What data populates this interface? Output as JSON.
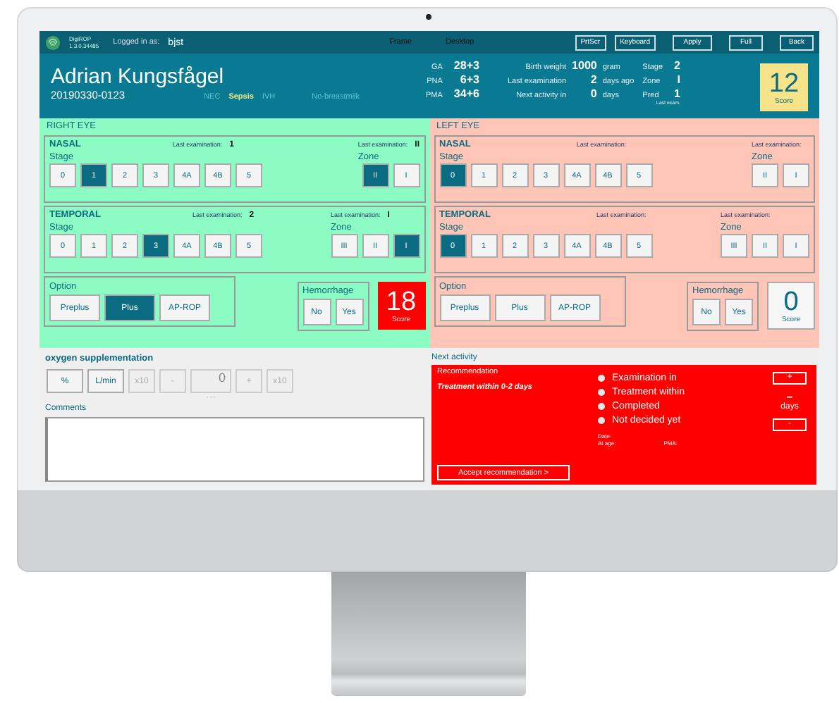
{
  "topbar": {
    "app_name": "DigiROP",
    "version": "1.3.0.34485",
    "logged_in_label": "Logged in as:",
    "user": "bjst",
    "views": [
      "Frame",
      "Desktop"
    ],
    "buttons": [
      "PrtScr",
      "Keyboard",
      "Apply",
      "Full",
      "Back"
    ]
  },
  "patient": {
    "name": "Adrian Kungsfågel",
    "id": "20190330-0123",
    "flags": [
      {
        "label": "NEC",
        "active": false
      },
      {
        "label": "Sepsis",
        "active": true
      },
      {
        "label": "IVH",
        "active": false
      },
      {
        "label": "No-breastmilk",
        "active": false
      }
    ],
    "ages": [
      {
        "label": "GA",
        "value": "28+3"
      },
      {
        "label": "PNA",
        "value": "6+3"
      },
      {
        "label": "PMA",
        "value": "34+6"
      }
    ],
    "facts": [
      {
        "label": "Birth weight",
        "value": "1000",
        "unit": "gram"
      },
      {
        "label": "Last examination",
        "value": "2",
        "unit": "days ago"
      },
      {
        "label": "Next activity in",
        "value": "0",
        "unit": "days"
      }
    ],
    "last_exam": [
      {
        "label": "Stage",
        "value": "2"
      },
      {
        "label": "Zone",
        "value": "I"
      },
      {
        "label": "Pred",
        "value": "1"
      }
    ],
    "last_exam_caption": "Last exam.",
    "score": "12",
    "score_label": "Score"
  },
  "eyes": [
    {
      "title": "RIGHT EYE",
      "color": "#8dfcc4",
      "alert": true,
      "score": "18",
      "score_label": "Score",
      "option_label": "Option",
      "hemorrhage_label": "Hemorrhage",
      "sections": [
        {
          "name": "NASAL",
          "last_stage_label": "Last examination:",
          "last_stage": "1",
          "last_zone_label": "Last examination:",
          "last_zone": "II",
          "stage_label": "Stage",
          "zone_label": "Zone",
          "stages": [
            {
              "label": "0",
              "selected": false
            },
            {
              "label": "1",
              "selected": true
            },
            {
              "label": "2",
              "selected": false
            },
            {
              "label": "3",
              "selected": false
            },
            {
              "label": "4A",
              "selected": false
            },
            {
              "label": "4B",
              "selected": false
            },
            {
              "label": "5",
              "selected": false
            }
          ],
          "zones": [
            {
              "label": "II",
              "selected": true
            },
            {
              "label": "I",
              "selected": false
            }
          ]
        },
        {
          "name": "TEMPORAL",
          "last_stage_label": "Last examination:",
          "last_stage": "2",
          "last_zone_label": "Last examination:",
          "last_zone": "I",
          "stage_label": "Stage",
          "zone_label": "Zone",
          "stages": [
            {
              "label": "0",
              "selected": false
            },
            {
              "label": "1",
              "selected": false
            },
            {
              "label": "2",
              "selected": false
            },
            {
              "label": "3",
              "selected": true
            },
            {
              "label": "4A",
              "selected": false
            },
            {
              "label": "4B",
              "selected": false
            },
            {
              "label": "5",
              "selected": false
            }
          ],
          "zones": [
            {
              "label": "III",
              "selected": false
            },
            {
              "label": "II",
              "selected": false
            },
            {
              "label": "I",
              "selected": true
            }
          ]
        }
      ],
      "options": [
        {
          "label": "Preplus",
          "selected": false
        },
        {
          "label": "Plus",
          "selected": true
        },
        {
          "label": "AP-ROP",
          "selected": false
        }
      ],
      "hemorrhage": [
        {
          "label": "No",
          "selected": false
        },
        {
          "label": "Yes",
          "selected": false
        }
      ]
    },
    {
      "title": "LEFT EYE",
      "color": "#ffc6b8",
      "alert": false,
      "score": "0",
      "score_label": "Score",
      "option_label": "Option",
      "hemorrhage_label": "Hemorrhage",
      "sections": [
        {
          "name": "NASAL",
          "last_stage_label": "Last examination:",
          "last_zone_label": "Last examination:",
          "stage_label": "Stage",
          "zone_label": "Zone",
          "stages": [
            {
              "label": "0",
              "selected": true
            },
            {
              "label": "1",
              "selected": false
            },
            {
              "label": "2",
              "selected": false
            },
            {
              "label": "3",
              "selected": false
            },
            {
              "label": "4A",
              "selected": false
            },
            {
              "label": "4B",
              "selected": false
            },
            {
              "label": "5",
              "selected": false
            }
          ],
          "zones": [
            {
              "label": "II",
              "selected": false
            },
            {
              "label": "I",
              "selected": false
            }
          ]
        },
        {
          "name": "TEMPORAL",
          "last_stage_label": "Last examination:",
          "last_zone_label": "Last examination:",
          "stage_label": "Stage",
          "zone_label": "Zone",
          "stages": [
            {
              "label": "0",
              "selected": true
            },
            {
              "label": "1",
              "selected": false
            },
            {
              "label": "2",
              "selected": false
            },
            {
              "label": "3",
              "selected": false
            },
            {
              "label": "4A",
              "selected": false
            },
            {
              "label": "4B",
              "selected": false
            },
            {
              "label": "5",
              "selected": false
            }
          ],
          "zones": [
            {
              "label": "III",
              "selected": false
            },
            {
              "label": "II",
              "selected": false
            },
            {
              "label": "I",
              "selected": false
            }
          ]
        }
      ],
      "options": [
        {
          "label": "Preplus",
          "selected": false
        },
        {
          "label": "Plus",
          "selected": false
        },
        {
          "label": "AP-ROP",
          "selected": false
        }
      ],
      "hemorrhage": [
        {
          "label": "No",
          "selected": false
        },
        {
          "label": "Yes",
          "selected": false
        }
      ]
    }
  ],
  "oxygen": {
    "title": "oxygen supplementation",
    "controls": [
      {
        "kind": "button",
        "label": "%",
        "disabled": false
      },
      {
        "kind": "button",
        "label": "L/min",
        "disabled": false
      },
      {
        "kind": "button",
        "label": "x10",
        "disabled": true
      },
      {
        "kind": "button",
        "label": "-",
        "disabled": true
      },
      {
        "kind": "value",
        "label": "0",
        "caption": "- - -"
      },
      {
        "kind": "button",
        "label": "+",
        "disabled": true
      },
      {
        "kind": "button",
        "label": "x10",
        "disabled": true
      }
    ]
  },
  "comments": {
    "label": "Comments"
  },
  "next_activity": {
    "title": "Next activity",
    "recommendation_label": "Recommendation",
    "recommendation": "Treatment within 0-2 days",
    "accept": "Accept recommendation  >",
    "choices": [
      {
        "label": "Examination in",
        "selected": false
      },
      {
        "label": "Treatment within",
        "selected": false
      },
      {
        "label": "Completed",
        "selected": false
      },
      {
        "label": "Not decided yet",
        "selected": false
      }
    ],
    "date_label": "Date:",
    "age_label": "At age:",
    "pma_label": "PMA:",
    "plus": "+",
    "days_value": "–",
    "days_unit": "days",
    "minus": "-"
  }
}
